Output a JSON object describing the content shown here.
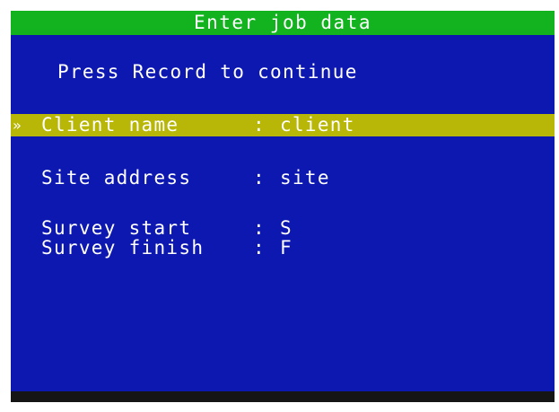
{
  "title": "Enter job data",
  "prompt": "Press Record to continue",
  "selected_marker": "»",
  "colon": ":",
  "fields": [
    {
      "label": "Client name",
      "value": "client",
      "selected": true
    },
    {
      "label": "Site address",
      "value": "site",
      "selected": false
    },
    {
      "label": "Survey start",
      "value": "S",
      "selected": false
    },
    {
      "label": "Survey finish",
      "value": "F",
      "selected": false
    }
  ],
  "colors": {
    "screen_background": "#0d18b0",
    "title_bar": "#13b21f",
    "selection_highlight": "#b8b607",
    "status_bar": "#151515",
    "text": "#ffffff"
  }
}
